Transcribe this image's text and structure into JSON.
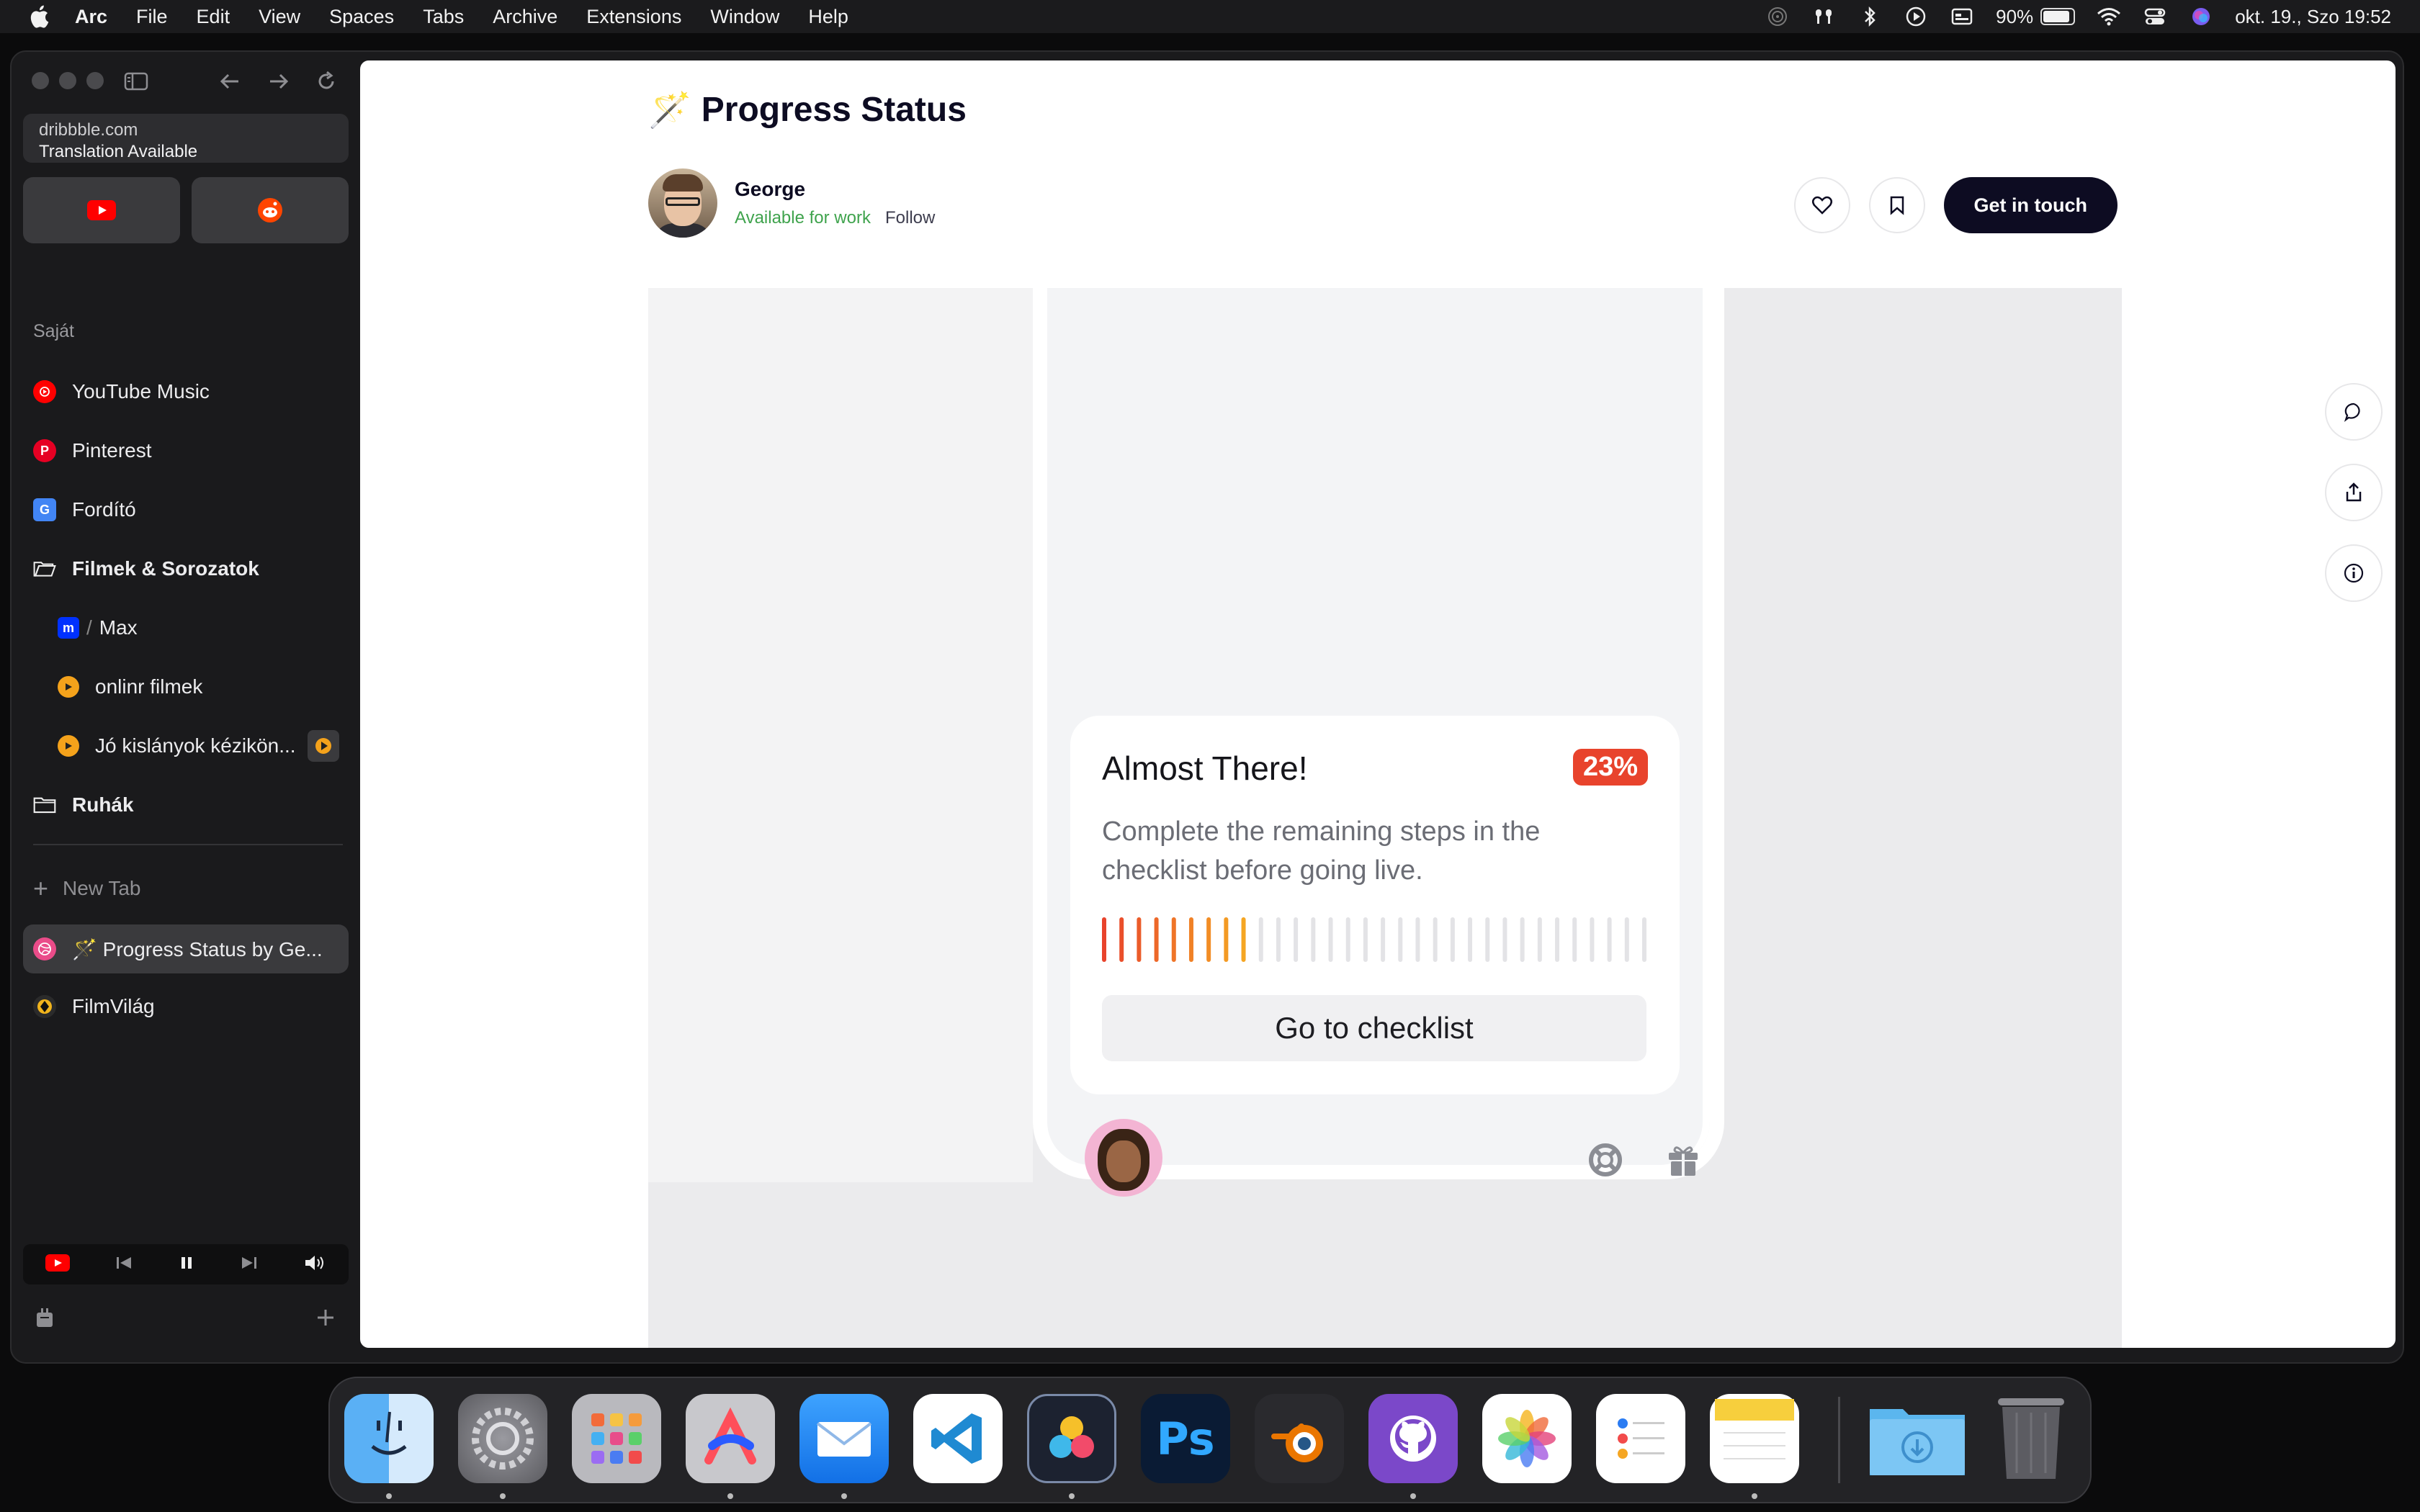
{
  "menubar": {
    "app": "Arc",
    "items": [
      "File",
      "Edit",
      "View",
      "Spaces",
      "Tabs",
      "Archive",
      "Extensions",
      "Window",
      "Help"
    ],
    "battery": "90%",
    "battery_level": 0.9,
    "datetime": "okt. 19., Szo  19:52"
  },
  "sidebar": {
    "url": "dribbble.com",
    "translation": "Translation Available",
    "section": "Saját",
    "items": [
      {
        "label": "YouTube Music",
        "icon": "youtube-music-icon"
      },
      {
        "label": "Pinterest",
        "icon": "pinterest-icon"
      },
      {
        "label": "Fordító",
        "icon": "google-translate-icon"
      },
      {
        "label": "Filmek & Sorozatok",
        "icon": "folder-open-icon"
      },
      {
        "label": "Max",
        "prefix": "m",
        "icon": "max-icon"
      },
      {
        "label": "onlinr filmek",
        "icon": "play-icon"
      },
      {
        "label": "Jó kislányok kézikön...",
        "icon": "play-icon"
      },
      {
        "label": "Ruhák",
        "icon": "folder-icon"
      }
    ],
    "new_tab": "New Tab",
    "tabs": [
      {
        "label": "🪄 Progress Status by Ge...",
        "icon": "dribbble-icon"
      },
      {
        "label": "FilmVilág",
        "icon": "filmvilag-icon"
      }
    ]
  },
  "shot": {
    "title": "Progress Status",
    "title_icon": "🪄",
    "author": "George",
    "availability": "Available for work",
    "follow": "Follow",
    "cta": "Get in touch"
  },
  "card": {
    "title": "Almost There!",
    "percent": "23%",
    "progress": 0.23,
    "description": "Complete the remaining steps in the checklist before going live.",
    "button": "Go to checklist",
    "colors": {
      "start": "#e8432c",
      "end": "#f5a623",
      "inactive": "#e3e3e6"
    }
  },
  "dock": {
    "apps": [
      "Finder",
      "System Settings",
      "Launchpad",
      "Arc",
      "Mail",
      "Visual Studio Code",
      "DaVinci Resolve",
      "Photoshop",
      "Blender",
      "GitHub Desktop",
      "Photos",
      "Reminders",
      "Notes",
      "Downloads",
      "Trash"
    ]
  }
}
